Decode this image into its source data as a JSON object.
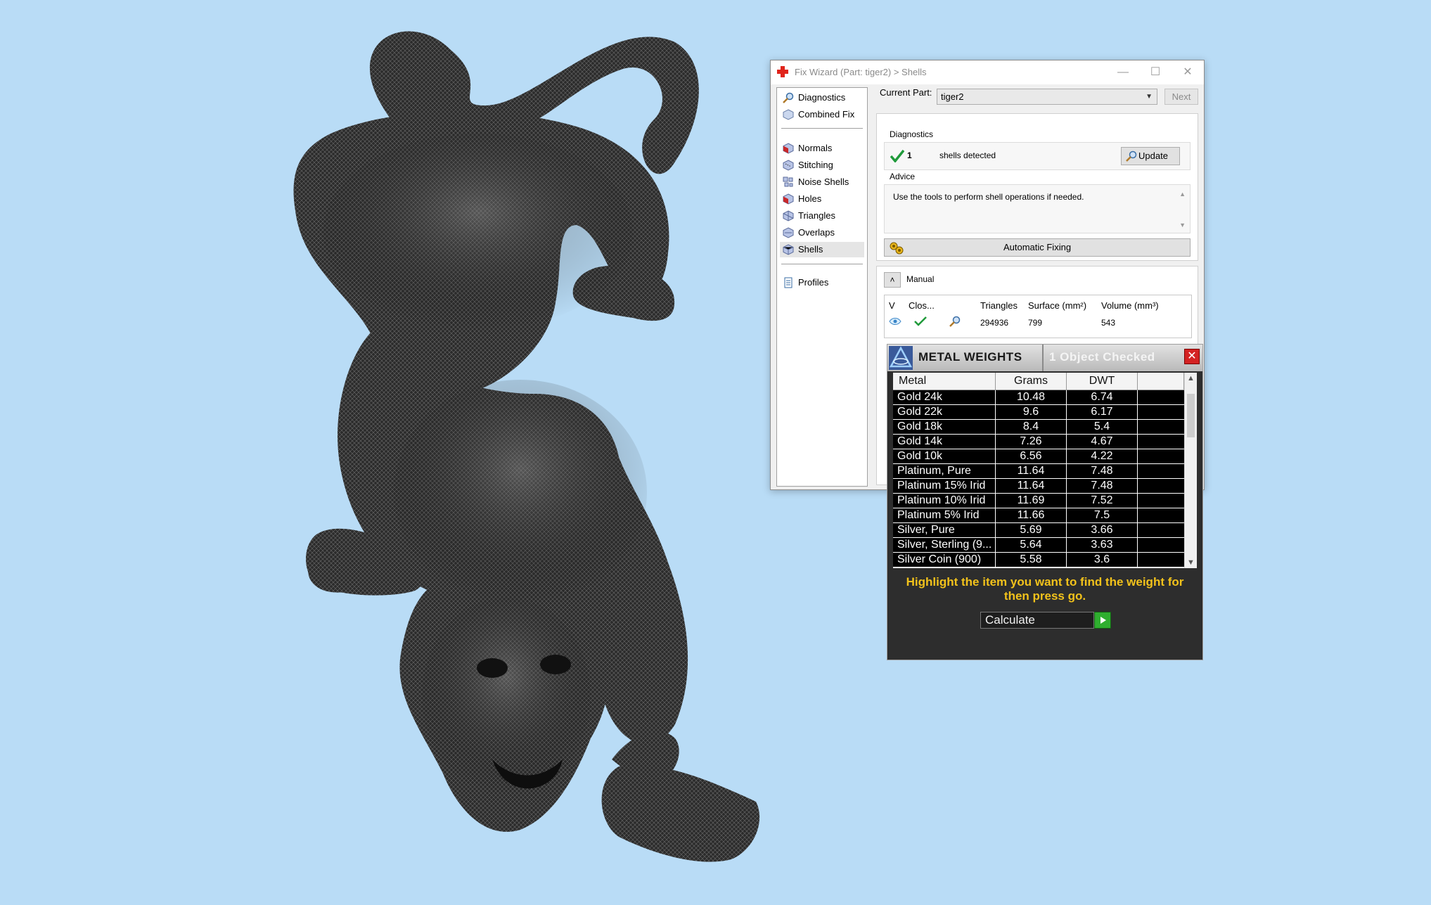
{
  "fix_wizard": {
    "title": "Fix Wizard (Part: tiger2) > Shells",
    "sidebar": {
      "top_items": [
        {
          "label": "Diagnostics",
          "icon": "magnifier-icon"
        },
        {
          "label": "Combined Fix",
          "icon": "cube-icon"
        }
      ],
      "items": [
        {
          "label": "Normals",
          "icon": "normals-cube-icon"
        },
        {
          "label": "Stitching",
          "icon": "stitching-cube-icon"
        },
        {
          "label": "Noise Shells",
          "icon": "noise-shells-icon"
        },
        {
          "label": "Holes",
          "icon": "holes-cube-icon"
        },
        {
          "label": "Triangles",
          "icon": "triangles-cube-icon"
        },
        {
          "label": "Overlaps",
          "icon": "overlaps-cube-icon"
        },
        {
          "label": "Shells",
          "icon": "shells-cube-icon",
          "selected": true
        }
      ],
      "bottom_items": [
        {
          "label": "Profiles",
          "icon": "document-icon"
        }
      ]
    },
    "current_part_label": "Current Part:",
    "current_part_value": "tiger2",
    "next_label": "Next",
    "diagnostics": {
      "title": "Diagnostics",
      "count": "1",
      "text": "shells detected",
      "update_label": "Update"
    },
    "advice": {
      "title": "Advice",
      "text": "Use the tools to perform shell operations if needed."
    },
    "automatic_fixing_label": "Automatic Fixing",
    "manual_label": "Manual",
    "table": {
      "headers": [
        "V",
        "Clos...",
        "",
        "Triangles",
        "Surface (mm²)",
        "Volume (mm³)"
      ],
      "rows": [
        {
          "triangles": "294936",
          "surface": "799",
          "volume": "543"
        }
      ]
    }
  },
  "metal_weights": {
    "title": "METAL WEIGHTS",
    "status": "1 Object Checked",
    "columns": [
      "Metal",
      "Grams",
      "DWT"
    ],
    "rows": [
      {
        "metal": "Gold 24k",
        "grams": "10.48",
        "dwt": "6.74"
      },
      {
        "metal": "Gold 22k",
        "grams": "9.6",
        "dwt": "6.17"
      },
      {
        "metal": "Gold 18k",
        "grams": "8.4",
        "dwt": "5.4"
      },
      {
        "metal": "Gold 14k",
        "grams": "7.26",
        "dwt": "4.67"
      },
      {
        "metal": "Gold 10k",
        "grams": "6.56",
        "dwt": "4.22"
      },
      {
        "metal": "Platinum, Pure",
        "grams": "11.64",
        "dwt": "7.48"
      },
      {
        "metal": "Platinum 15% Irid",
        "grams": "11.64",
        "dwt": "7.48"
      },
      {
        "metal": "Platinum 10% Irid",
        "grams": "11.69",
        "dwt": "7.52"
      },
      {
        "metal": "Platinum 5% Irid",
        "grams": "11.66",
        "dwt": "7.5"
      },
      {
        "metal": "Silver, Pure",
        "grams": "5.69",
        "dwt": "3.66"
      },
      {
        "metal": "Silver, Sterling (9...",
        "grams": "5.64",
        "dwt": "3.63"
      },
      {
        "metal": "Silver Coin (900)",
        "grams": "5.58",
        "dwt": "3.6"
      }
    ],
    "hint_line1": "Highlight the item you want to find the weight for",
    "hint_line2": "then press go.",
    "calculate_label": "Calculate"
  },
  "colors": {
    "background": "#b9dcf6",
    "mesh": "#2a2a2a",
    "check_green": "#1f9a3a",
    "hint_yellow": "#f2c21b",
    "close_red": "#d42222"
  }
}
